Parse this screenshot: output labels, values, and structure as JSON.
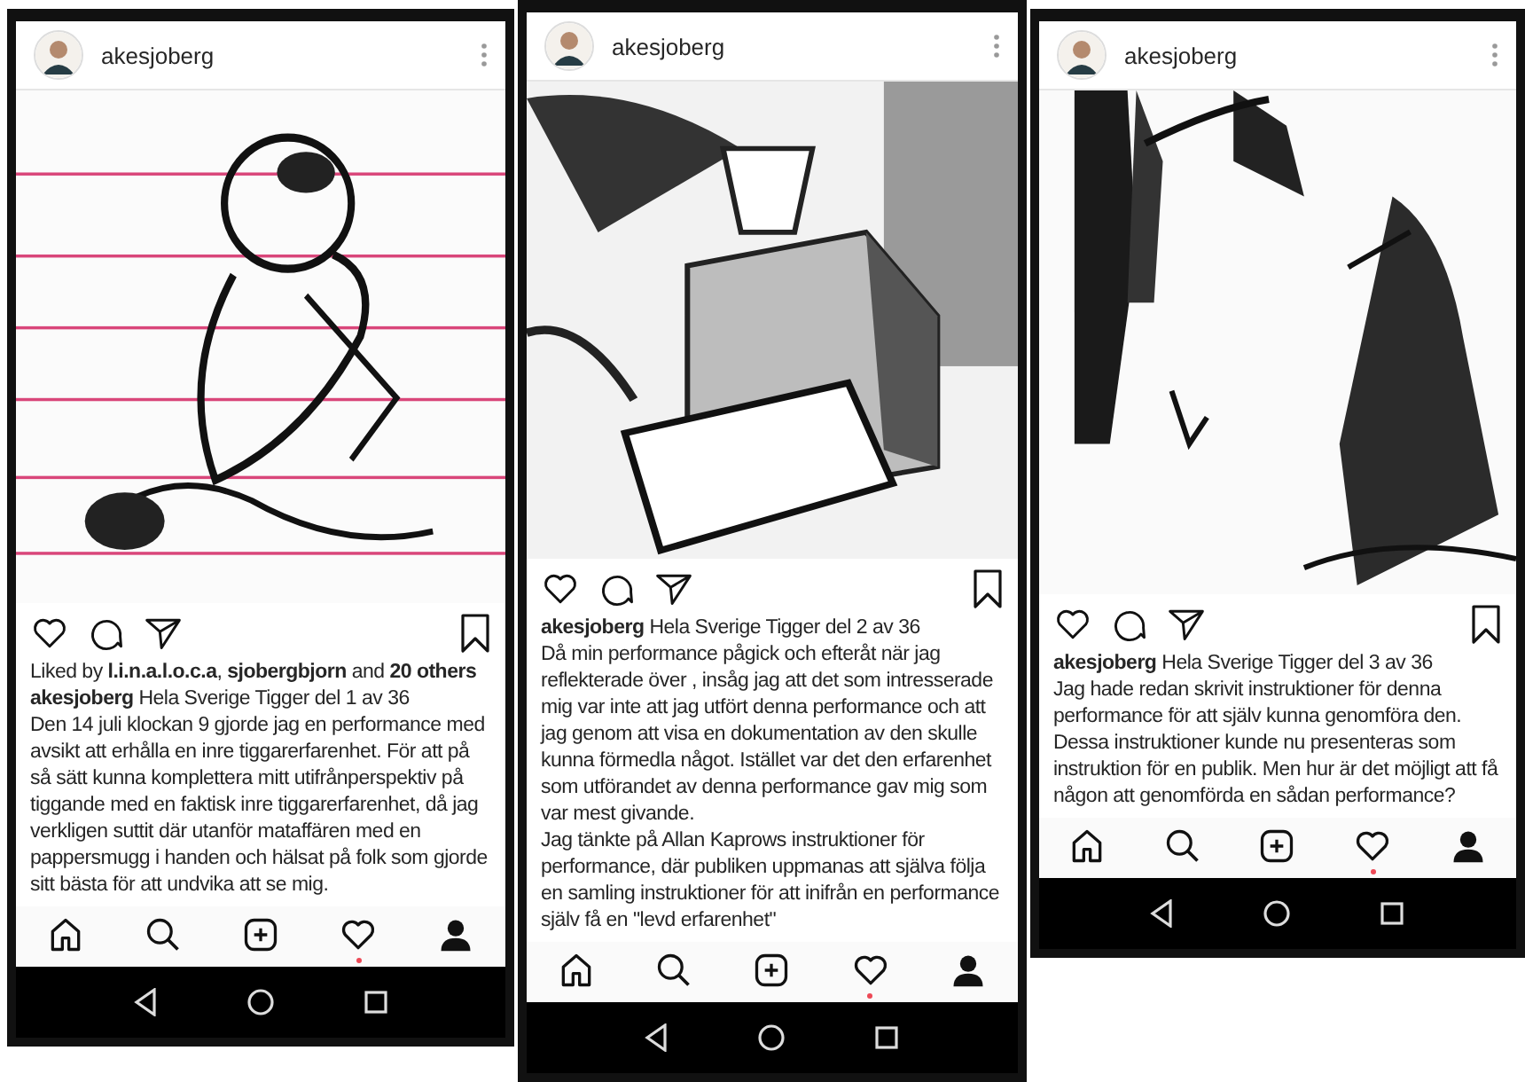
{
  "phones": [
    {
      "username": "akesjoberg",
      "liked": false,
      "saved": false,
      "likes_line": "Liked by **l.i.n.a.l.o.c.a**, **sjobergbjorn** and **20 others**",
      "caption": {
        "username": "akesjoberg",
        "title": "Hela Sverige Tigger del 1 av 36"
      },
      "paragraphs": [
        "Den 14 juli klockan 9 gjorde jag en performance med avsikt att erhålla en inre tiggarerfarenhet. För att på så sätt kunna komplettera mitt utifrånperspektiv på tiggande med en faktisk inre tiggarerfarenhet, då jag verkligen suttit där utanför mataffären med en pappersmugg i handen och hälsat på folk som gjorde sitt bästa för att undvika att se mig."
      ],
      "tabs": [
        {
          "kind": "home",
          "notification": false
        },
        {
          "kind": "search",
          "notification": false
        },
        {
          "kind": "add",
          "notification": false
        },
        {
          "kind": "activity",
          "notification": true
        },
        {
          "kind": "profile",
          "notification": false
        }
      ]
    },
    {
      "username": "akesjoberg",
      "liked": false,
      "saved": false,
      "caption": {
        "username": "akesjoberg",
        "title": "Hela Sverige Tigger del 2 av 36"
      },
      "paragraphs": [
        "Då min performance pågick och efteråt när jag reflekterade över , insåg jag att det som intresserade mig var inte att jag utfört denna performance och att jag genom att visa en dokumentation av den skulle kunna förmedla något. Istället var det den erfarenhet som utförandet av denna performance gav mig som var mest givande.",
        "Jag tänkte på Allan Kaprows instruktioner för performance, där publiken uppmanas att själva följa en samling instruktioner för att inifrån en performance själv få en \"levd erfarenhet\""
      ],
      "tabs": [
        {
          "kind": "home",
          "notification": false
        },
        {
          "kind": "search",
          "notification": false
        },
        {
          "kind": "add",
          "notification": false
        },
        {
          "kind": "activity",
          "notification": true
        },
        {
          "kind": "profile",
          "notification": false
        }
      ]
    },
    {
      "username": "akesjoberg",
      "liked": false,
      "saved": false,
      "caption": {
        "username": "akesjoberg",
        "title": "Hela Sverige Tigger del 3 av 36"
      },
      "paragraphs": [
        "Jag hade redan skrivit instruktioner för denna performance för att själv kunna genomföra den. Dessa instruktioner kunde nu presenteras som instruktion för en publik. Men hur är det möjligt att få någon att genomförda en sådan performance?"
      ],
      "tabs": [
        {
          "kind": "home",
          "notification": false
        },
        {
          "kind": "search",
          "notification": false
        },
        {
          "kind": "add",
          "notification": false
        },
        {
          "kind": "activity",
          "notification": true
        },
        {
          "kind": "profile",
          "notification": false
        }
      ]
    }
  ]
}
